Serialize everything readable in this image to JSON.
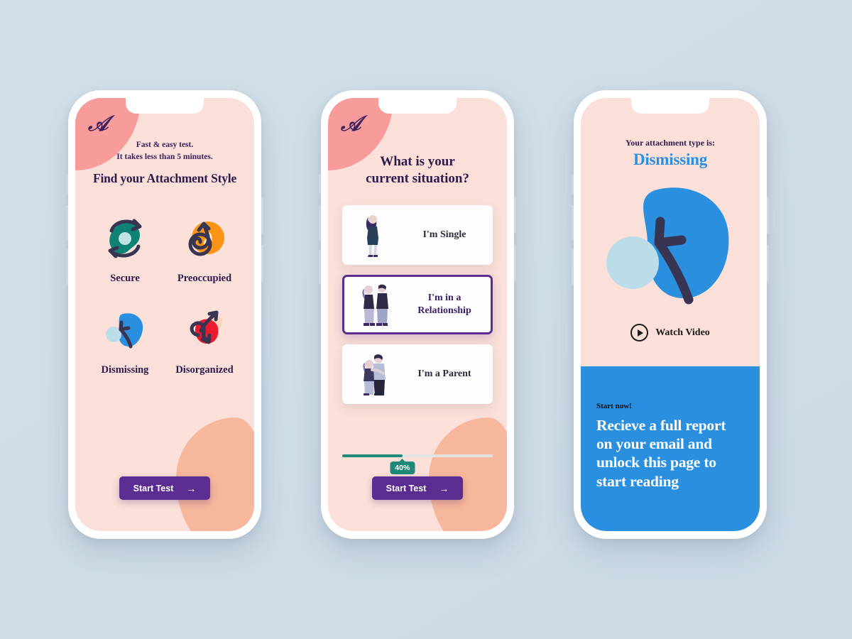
{
  "canvas": {
    "background": "#cfdfe8"
  },
  "brand": {
    "logo_letter": "A",
    "purple": "#5c2d91",
    "pink_corner": "#f79b9b",
    "screen_bg": "#fae0d8",
    "blue": "#2b8fe0",
    "teal": "#1f8a78"
  },
  "screen1": {
    "name": "intro-screen",
    "subtitle_line1": "Fast & easy test.",
    "subtitle_line2": "It takes less than 5 minutes.",
    "title": "Find your Attachment Style",
    "styles": [
      {
        "label": "Secure",
        "icon": "secure-swirl-icon",
        "color": "#0f8276"
      },
      {
        "label": "Preoccupied",
        "icon": "preoccupied-spiral-icon",
        "color": "#f99417"
      },
      {
        "label": "Dismissing",
        "icon": "dismissing-blob-icon",
        "color": "#2b8fe0"
      },
      {
        "label": "Disorganized",
        "icon": "disorganized-blob-icon",
        "color": "#ea1b2d"
      }
    ],
    "cta": {
      "label": "Start Test",
      "arrow": "→"
    }
  },
  "screen2": {
    "name": "question-screen",
    "question_line1": "What is your",
    "question_line2": "current situation?",
    "options": [
      {
        "label": "I'm Single",
        "label_line2": "",
        "icon": "single-person-illustration",
        "selected": false
      },
      {
        "label": "I'm in a",
        "label_line2": "Relationship",
        "icon": "couple-illustration",
        "selected": true
      },
      {
        "label": "I'm a Parent",
        "label_line2": "",
        "icon": "parent-couple-illustration",
        "selected": false
      }
    ],
    "progress": {
      "percent_label": "40%",
      "percent_value": 40
    },
    "cta": {
      "label": "Start Test",
      "arrow": "→"
    }
  },
  "screen3": {
    "name": "result-screen",
    "eyebrow": "Your attachment type is:",
    "type_name": "Dismissing",
    "watch_label": "Watch Video",
    "watch_icon": "play-icon",
    "cta_eyebrow": "Start now!",
    "cta_headline": "Recieve a full report on your email and unlock this page to start reading"
  }
}
